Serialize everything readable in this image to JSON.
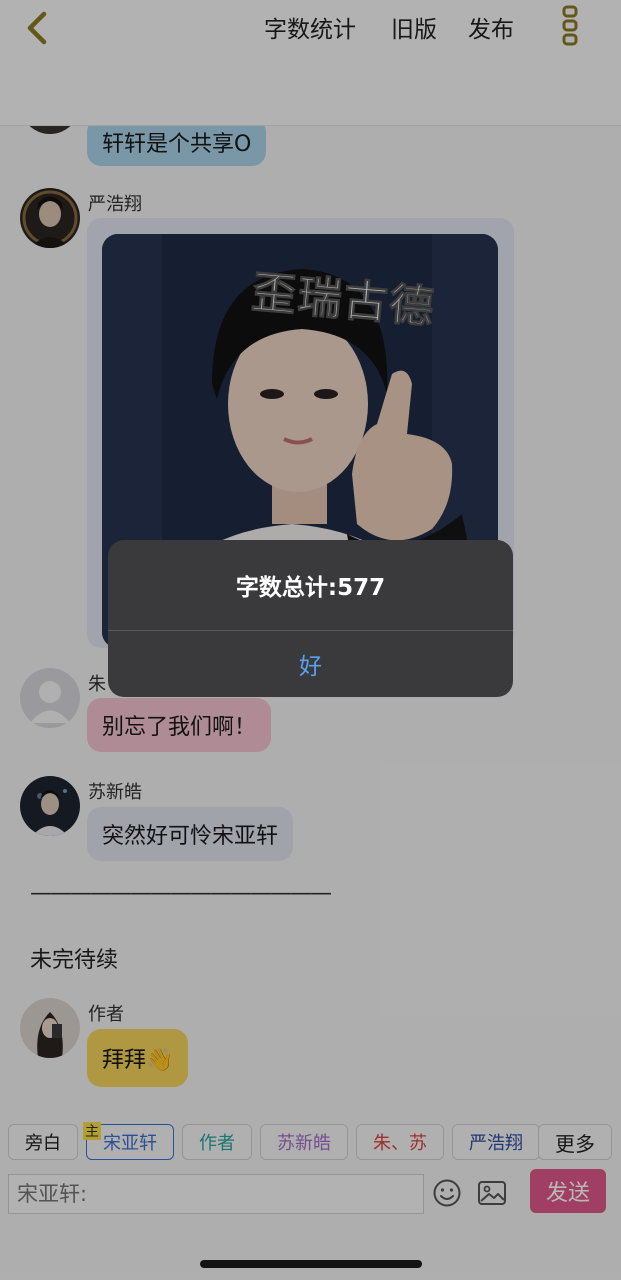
{
  "topbar": {
    "word_count_label": "字数统计",
    "old_version_label": "旧版",
    "publish_label": "发布"
  },
  "messages": {
    "m1": {
      "text": "轩轩是个共享O",
      "color": "#a8d2e6"
    },
    "m2": {
      "name": "严浩翔",
      "image_caption": "歪瑞古德"
    },
    "m3": {
      "name_partial": "朱",
      "text": "别忘了我们啊！",
      "color": "#f3c2cf"
    },
    "m4": {
      "name": "苏新皓",
      "text": "突然好可怜宋亚轩",
      "color": "#dfe2ec"
    },
    "divider": "———————————————",
    "narration": "未完待续",
    "m5": {
      "name": "作者",
      "text": "拜拜👋",
      "color": "#f3d35b"
    }
  },
  "alert": {
    "title": "字数总计:577",
    "ok_label": "好"
  },
  "characters": {
    "narrator": "旁白",
    "host_badge": "主",
    "items": [
      {
        "label": "宋亚轩",
        "color": "#3d6fd1"
      },
      {
        "label": "作者",
        "color": "#26a39a"
      },
      {
        "label": "苏新皓",
        "color": "#a36cc9"
      },
      {
        "label": "朱、苏",
        "color": "#d9443c"
      },
      {
        "label": "严浩翔",
        "color": "#2f4ea3"
      }
    ],
    "more": "更多"
  },
  "composer": {
    "placeholder": "宋亚轩:",
    "send_label": "发送"
  }
}
